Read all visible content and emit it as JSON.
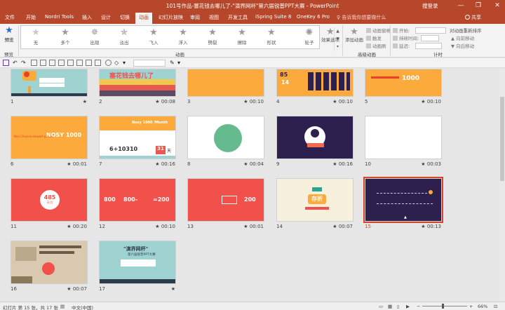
{
  "window": {
    "title": "101号作品-塞花钱去哪儿了-\"演界网杯\"第六届锐普PPT大赛 - PowerPoint",
    "login": "搜登录",
    "controls": {
      "minimize": "—",
      "restore": "❐",
      "close": "✕"
    }
  },
  "tabs": [
    {
      "label": "文件"
    },
    {
      "label": "开始"
    },
    {
      "label": "Nordri Tools"
    },
    {
      "label": "插入"
    },
    {
      "label": "设计"
    },
    {
      "label": "切换"
    },
    {
      "label": "动画",
      "active": true
    },
    {
      "label": "幻灯片放映"
    },
    {
      "label": "审阅"
    },
    {
      "label": "视图"
    },
    {
      "label": "开发工具"
    },
    {
      "label": "iSpring Suite 8"
    },
    {
      "label": "OneKey 6 Pro"
    }
  ],
  "tell_me": "告诉我你想要做什么",
  "share": "共享",
  "ribbon": {
    "preview": {
      "label": "预览",
      "group": "预览"
    },
    "animations": [
      {
        "label": "无",
        "icon": "star-none-icon"
      },
      {
        "label": "多个",
        "icon": "star-icon"
      },
      {
        "label": "出现",
        "icon": "star-icon"
      },
      {
        "label": "淡出",
        "icon": "star-icon"
      },
      {
        "label": "飞入",
        "icon": "star-icon"
      },
      {
        "label": "浮入",
        "icon": "star-icon"
      },
      {
        "label": "劈裂",
        "icon": "star-icon"
      },
      {
        "label": "擦除",
        "icon": "star-icon"
      },
      {
        "label": "形状",
        "icon": "star-icon"
      },
      {
        "label": "轮子",
        "icon": "star-icon"
      }
    ],
    "effect_options": "效果选项",
    "animation_group": "动画",
    "add_animation": "添加动画",
    "animation_pane": "动画窗格",
    "trigger": "触发",
    "animation_painter": "动画刷",
    "advanced_group": "高级动画",
    "start_label": "开始:",
    "duration_label": "持续时间:",
    "delay_label": "延迟:",
    "reorder_title": "对动画重新排序",
    "move_earlier": "向前移动",
    "move_later": "向后移动",
    "timing_group": "计时"
  },
  "slides": [
    {
      "num": "1",
      "time": ""
    },
    {
      "num": "2",
      "time": "00:08"
    },
    {
      "num": "3",
      "time": "00:10"
    },
    {
      "num": "4",
      "time": "00:10"
    },
    {
      "num": "5",
      "time": "00:10"
    },
    {
      "num": "6",
      "time": "00:01"
    },
    {
      "num": "7",
      "time": "00:16"
    },
    {
      "num": "8",
      "time": "00:04"
    },
    {
      "num": "9",
      "time": "00:16"
    },
    {
      "num": "10",
      "time": "00:03"
    },
    {
      "num": "11",
      "time": "00:20"
    },
    {
      "num": "12",
      "time": "00:10"
    },
    {
      "num": "13",
      "time": "00:01"
    },
    {
      "num": "14",
      "time": "00:07"
    },
    {
      "num": "15",
      "time": "00:13",
      "selected": true
    },
    {
      "num": "16",
      "time": "00:07"
    },
    {
      "num": "17",
      "time": ""
    }
  ],
  "slide_text": {
    "s2_title": "塞花钱去哪儿了",
    "s4_big": "85",
    "s4_mid": "14",
    "s5_big": "1000",
    "s6_lead": "Neo Chinese stewart packet",
    "s6_big": "NOSY 1000",
    "s6_tail": "/Month",
    "s7_top": "Nosy 1000 /Month",
    "s7_nums": "6+10310",
    "s7_tail": "31",
    "s7_unit": "天",
    "s9_ribbon": "",
    "s11_big": "485",
    "s11_small": "天/月",
    "s12_a": "800",
    "s12_b": "800-",
    "s12_c": "=200",
    "s13_big": "200",
    "s14_word": "存折",
    "s17_title": "\"演界网杯\"",
    "s17_sub": "第六届锐普PPT大赛"
  },
  "status": {
    "slide_info": "幻灯片 第 15 张，共 17 张",
    "language": "中文(中国)",
    "zoom": "66%"
  },
  "colors": {
    "accent": "#b7472a",
    "orange": "#fcaa3b",
    "red": "#f2504b",
    "teal": "#9fd3d1",
    "purple": "#2d1f4e",
    "green": "#66bb8e"
  }
}
